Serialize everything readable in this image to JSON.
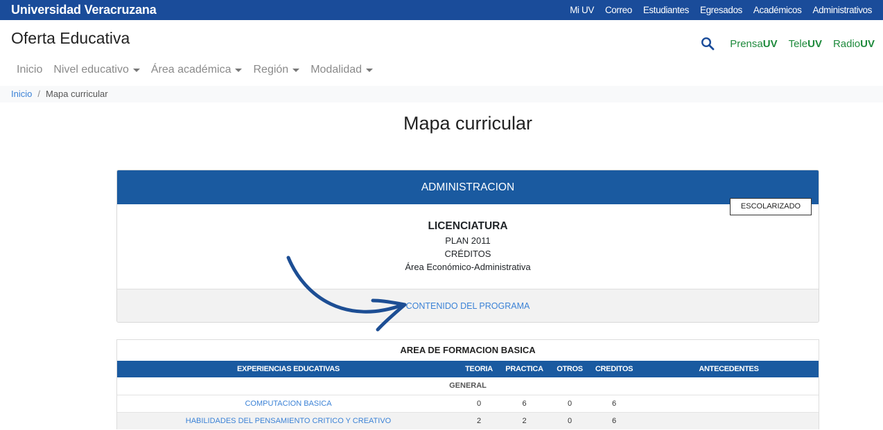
{
  "topbar": {
    "brand": "Universidad Veracruzana",
    "links": [
      "Mi UV",
      "Correo",
      "Estudiantes",
      "Egresados",
      "Académicos",
      "Administrativos"
    ]
  },
  "header": {
    "title": "Oferta Educativa",
    "nav": [
      "Inicio",
      "Nivel educativo",
      "Área académica",
      "Región",
      "Modalidad"
    ],
    "media": [
      {
        "pre": "Prensa",
        "post": "UV"
      },
      {
        "pre": "Tele",
        "post": "UV"
      },
      {
        "pre": "Radio",
        "post": "UV"
      }
    ]
  },
  "breadcrumb": {
    "home": "Inicio",
    "current": "Mapa curricular"
  },
  "page_title": "Mapa curricular",
  "program": {
    "name": "ADMINISTRACION",
    "modality": "ESCOLARIZADO",
    "level": "LICENCIATURA",
    "plan": "PLAN 2011",
    "credits": "CRÉDITOS",
    "area": "Área Económico-Administrativa",
    "content_link": "CONTENIDO DEL PROGRAMA"
  },
  "table": {
    "area_title": "AREA DE FORMACION BASICA",
    "headers": {
      "exp": "EXPERIENCIAS EDUCATIVAS",
      "teoria": "TEORIA",
      "practica": "PRACTICA",
      "otros": "OTROS",
      "creditos": "CREDITOS",
      "antecedentes": "ANTECEDENTES"
    },
    "group": "GENERAL",
    "rows": [
      {
        "exp": "COMPUTACION BASICA",
        "teoria": "0",
        "practica": "6",
        "otros": "0",
        "creditos": "6",
        "antecedentes": ""
      },
      {
        "exp": "HABILIDADES DEL PENSAMIENTO CRITICO Y CREATIVO",
        "teoria": "2",
        "practica": "2",
        "otros": "0",
        "creditos": "6",
        "antecedentes": ""
      }
    ]
  },
  "colors": {
    "primary": "#1a5aa0",
    "topbar": "#1a4c9a",
    "link": "#3b82d6",
    "media_green": "#1e8a3c"
  }
}
